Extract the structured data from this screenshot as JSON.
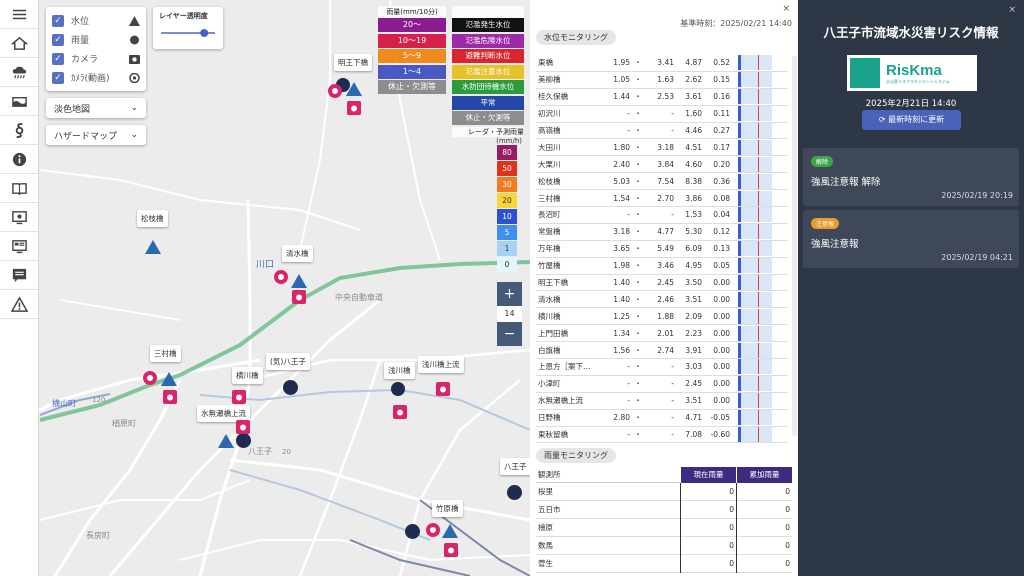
{
  "sidebar": {
    "icons": [
      "menu-icon",
      "home-icon",
      "rain-icon",
      "river-icon",
      "typhoon-icon",
      "info-icon",
      "book-icon",
      "monitor-icon",
      "dashboard-icon",
      "message-icon",
      "warning-icon"
    ]
  },
  "layers": {
    "items": [
      {
        "label": "水位",
        "icon": "triangle"
      },
      {
        "label": "雨量",
        "icon": "circle"
      },
      {
        "label": "カメラ",
        "icon": "camera"
      },
      {
        "label": "ｶﾒﾗ(動画)",
        "icon": "aperture"
      }
    ]
  },
  "opacity": {
    "title": "レイヤー透明度",
    "value": 0.8
  },
  "basemap": {
    "selected": "淡色地図"
  },
  "hazard": {
    "selected": "ハザードマップ"
  },
  "rain_legend": {
    "header_left": "雨量(mm/10分)",
    "header_right": "",
    "rows": [
      {
        "left": "20～",
        "left_color": "#8b1c8f",
        "right": "氾濫発生水位",
        "right_color": "#111111"
      },
      {
        "left": "10～19",
        "left_color": "#d6204a",
        "right": "氾濫危険水位",
        "right_color": "#9c2aa6"
      },
      {
        "left": "5～9",
        "left_color": "#f08a1c",
        "right": "避難判断水位",
        "right_color": "#d8262c"
      },
      {
        "left": "1～4",
        "left_color": "#4a58c6",
        "right": "氾濫注意水位",
        "right_color": "#e7c12a"
      },
      {
        "left": "休止・欠測等",
        "left_color": "#8d8d8d",
        "right": "水防団待機水位",
        "right_color": "#2a9d3a"
      },
      {
        "left": "",
        "left_color": "transparent",
        "right": "平常",
        "right_color": "#2447a9"
      },
      {
        "left": "",
        "left_color": "transparent",
        "right": "休止・欠測等",
        "right_color": "#8d8d8d"
      }
    ]
  },
  "radar": {
    "title": "レーダ・予測雨量",
    "unit": "(mm/h)",
    "levels": [
      {
        "label": "80",
        "color": "#9b1b62"
      },
      {
        "label": "50",
        "color": "#e0331e"
      },
      {
        "label": "30",
        "color": "#f37a20"
      },
      {
        "label": "20",
        "color": "#f9d53a"
      },
      {
        "label": "10",
        "color": "#2d4fd1"
      },
      {
        "label": "5",
        "color": "#3f8ef2"
      },
      {
        "label": "1",
        "color": "#a6d2f8"
      },
      {
        "label": "0",
        "color": "#e3f6fb"
      }
    ]
  },
  "zoom": {
    "plus": "+",
    "level": "14",
    "minus": "−"
  },
  "map_labels": [
    {
      "text": "明王下橋"
    },
    {
      "text": "松枝橋"
    },
    {
      "text": "清水橋"
    },
    {
      "text": "三村橋"
    },
    {
      "text": "(気)八王子"
    },
    {
      "text": "横川橋"
    },
    {
      "text": "浅川橋"
    },
    {
      "text": "浅川橋上流"
    },
    {
      "text": "水無瀬橋上流"
    },
    {
      "text": "八王子"
    },
    {
      "text": "竹原橋"
    }
  ],
  "map_text": [
    "川口",
    "中央自動車道",
    "楢原町",
    "横山町",
    "八王子",
    "長房町",
    "120",
    "20"
  ],
  "middle": {
    "close": "×",
    "timestamp": "基準時刻：2025/02/21 14:40",
    "water_title": "水位モニタリング",
    "water_rows": [
      {
        "name": "東橋",
        "a": "1.95",
        "b": "・",
        "c": "3.41",
        "d": "4.87",
        "e": "0.52"
      },
      {
        "name": "美柳橋",
        "a": "1.05",
        "b": "・",
        "c": "1.63",
        "d": "2.62",
        "e": "0.15"
      },
      {
        "name": "桂久保橋",
        "a": "1.44",
        "b": "・",
        "c": "2.53",
        "d": "3.61",
        "e": "0.16"
      },
      {
        "name": "初沢川",
        "a": "-",
        "b": "・",
        "c": "-",
        "d": "1.60",
        "e": "0.11"
      },
      {
        "name": "高嶺橋",
        "a": "-",
        "b": "・",
        "c": "-",
        "d": "4.46",
        "e": "0.27"
      },
      {
        "name": "大田川",
        "a": "1.80",
        "b": "・",
        "c": "3.18",
        "d": "4.51",
        "e": "0.17"
      },
      {
        "name": "大栗川",
        "a": "2.40",
        "b": "・",
        "c": "3.84",
        "d": "4.60",
        "e": "0.20"
      },
      {
        "name": "松枝橋",
        "a": "5.03",
        "b": "・",
        "c": "7.54",
        "d": "8.38",
        "e": "0.36"
      },
      {
        "name": "三村橋",
        "a": "1.54",
        "b": "・",
        "c": "2.70",
        "d": "3.86",
        "e": "0.08"
      },
      {
        "name": "長沼町",
        "a": "-",
        "b": "・",
        "c": "-",
        "d": "1.53",
        "e": "0.04"
      },
      {
        "name": "常盤橋",
        "a": "3.18",
        "b": "・",
        "c": "4.77",
        "d": "5.30",
        "e": "0.12"
      },
      {
        "name": "万年橋",
        "a": "3.65",
        "b": "・",
        "c": "5.49",
        "d": "6.09",
        "e": "0.13"
      },
      {
        "name": "竹屋橋",
        "a": "1.98",
        "b": "・",
        "c": "3.46",
        "d": "4.95",
        "e": "0.05"
      },
      {
        "name": "明王下橋",
        "a": "1.40",
        "b": "・",
        "c": "2.45",
        "d": "3.50",
        "e": "0.00"
      },
      {
        "name": "清水橋",
        "a": "1.40",
        "b": "・",
        "c": "2.46",
        "d": "3.51",
        "e": "0.00"
      },
      {
        "name": "横川橋",
        "a": "1.25",
        "b": "・",
        "c": "1.88",
        "d": "2.09",
        "e": "0.00"
      },
      {
        "name": "上門田橋",
        "a": "1.34",
        "b": "・",
        "c": "2.01",
        "d": "2.23",
        "e": "0.00"
      },
      {
        "name": "白旗橋",
        "a": "1.56",
        "b": "・",
        "c": "2.74",
        "d": "3.91",
        "e": "0.00"
      },
      {
        "name": "上恩方［案下…",
        "a": "-",
        "b": "・",
        "c": "-",
        "d": "3.03",
        "e": "0.00"
      },
      {
        "name": "小津町",
        "a": "-",
        "b": "・",
        "c": "-",
        "d": "2.45",
        "e": "0.00"
      },
      {
        "name": "水無瀬橋上流",
        "a": "-",
        "b": "・",
        "c": "-",
        "d": "3.51",
        "e": "0.00"
      },
      {
        "name": "日野橋",
        "a": "2.80",
        "b": "・",
        "c": "-",
        "d": "4.71",
        "e": "-0.05"
      },
      {
        "name": "東秋留橋",
        "a": "-",
        "b": "・",
        "c": "-",
        "d": "7.08",
        "e": "-0.60"
      }
    ],
    "rain_title": "雨量モニタリング",
    "rain_header": {
      "name": "観測所",
      "current": "現在雨量",
      "cumulative": "累加雨量"
    },
    "rain_rows": [
      {
        "name": "桜里",
        "current": "0",
        "cumulative": "0"
      },
      {
        "name": "五日市",
        "current": "0",
        "cumulative": "0"
      },
      {
        "name": "檜原",
        "current": "0",
        "cumulative": "0"
      },
      {
        "name": "数馬",
        "current": "0",
        "cumulative": "0"
      },
      {
        "name": "菅生",
        "current": "0",
        "cumulative": "0"
      }
    ]
  },
  "right": {
    "close": "×",
    "title": "八王子市流域水災害リスク情報",
    "logo_text": "RisKma",
    "logo_sub": "水災害リスクマネジメントシステム",
    "date": "2025年2月21日 14:40",
    "refresh_label": "最新時刻に更新",
    "cards": [
      {
        "badge": "解除",
        "badge_color": "#3aa64a",
        "title": "強風注意報 解除",
        "time": "2025/02/19 20:19"
      },
      {
        "badge": "注意報",
        "badge_color": "#e89a2a",
        "title": "強風注意報",
        "time": "2025/02/19 04:21"
      }
    ]
  }
}
